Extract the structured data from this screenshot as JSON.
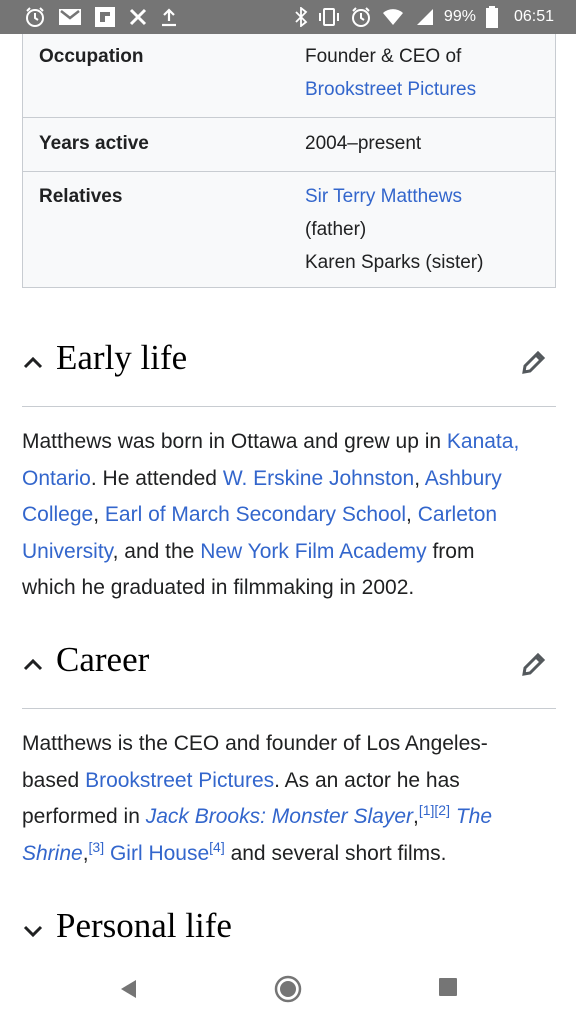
{
  "status": {
    "battery": "99%",
    "time": "06:51"
  },
  "infobox": {
    "occupation_label": "Occupation",
    "occupation_text": "Founder & CEO of",
    "occupation_link": "Brookstreet Pictures",
    "years_label": "Years active",
    "years_value": "2004–present",
    "relatives_label": "Relatives",
    "relative1_link": "Sir Terry Matthews",
    "relative1_note": "(father)",
    "relative2": "Karen Sparks (sister)"
  },
  "early_life": {
    "title": "Early life",
    "t1": "Matthews was born in Ottawa and grew up in ",
    "l_kanata": "Kanata,",
    "l_ontario": "Ontario",
    "t2": ". He attended ",
    "l_erskine": "W. Erskine Johnston",
    "t3": ", ",
    "l_ashbury1": "Ashbury",
    "l_ashbury2": "College",
    "t4": ", ",
    "l_earl": "Earl of March Secondary School",
    "t5": ", ",
    "l_carleton1": "Carleton",
    "l_carleton2": "University",
    "t6": ", and the ",
    "l_nyfa": "New York Film Academy",
    "t7": " from",
    "t8": "which he graduated in filmmaking in 2002."
  },
  "career": {
    "title": "Career",
    "t1": "Matthews is the CEO and founder of Los Angeles-",
    "t2": "based ",
    "l_brookstreet": "Brookstreet Pictures",
    "t3": ". As an actor he has",
    "t4": "performed in ",
    "l_jack": "Jack Brooks: Monster Slayer",
    "t5": ",",
    "ref1": "[1]",
    "ref2": "[2]",
    "l_the": " The",
    "l_shrine": "Shrine",
    "t6": ",",
    "ref3": "[3]",
    "l_girl": " Girl House",
    "ref4": "[4]",
    "t7": " and several short films."
  },
  "personal_life": {
    "title": "Personal life"
  },
  "nav": {
    "back": "back",
    "home": "home",
    "recents": "recents"
  }
}
